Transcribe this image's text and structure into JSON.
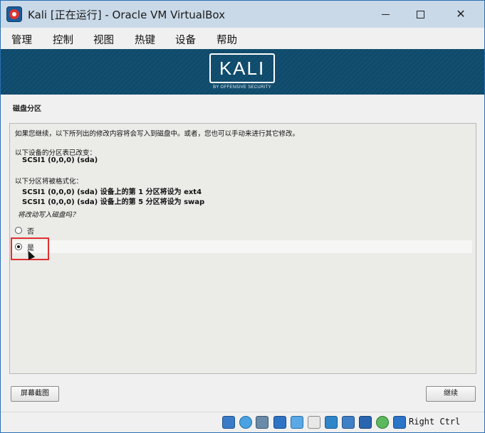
{
  "window": {
    "title": "Kali [正在运行] - Oracle VM VirtualBox"
  },
  "menu": {
    "items": [
      "管理",
      "控制",
      "视图",
      "热键",
      "设备",
      "帮助"
    ]
  },
  "banner": {
    "logo_text": "KALI",
    "logo_subtext": "BY OFFENSIVE SECURITY"
  },
  "installer": {
    "section_title": "磁盘分区",
    "intro": "如果您继续，以下所列出的修改内容将会写入到磁盘中。或者，您也可以手动来进行其它修改。",
    "partition_tables_label": "以下设备的分区表已改变：",
    "partition_tables_device": "SCSI1 (0,0,0) (sda)",
    "format_label": "以下分区将被格式化：",
    "format_items": [
      "SCSI1 (0,0,0) (sda) 设备上的第 1 分区将设为 ext4",
      "SCSI1 (0,0,0) (sda) 设备上的第 5 分区将设为 swap"
    ],
    "question": "将改动写入磁盘吗？",
    "options": [
      {
        "label": "否",
        "selected": false
      },
      {
        "label": "是",
        "selected": true
      }
    ],
    "screenshot_button": "屏幕截图",
    "continue_button": "继续"
  },
  "statusbar": {
    "host_key": "Right Ctrl",
    "icons": [
      "hard-disk-icon",
      "optical-drive-icon",
      "audio-icon",
      "network-icon",
      "usb-icon",
      "shared-folder-icon",
      "display-icon",
      "screen-capture-icon",
      "network-activity-icon",
      "virtualization-icon",
      "mouse-integration-icon",
      "keyboard-capture-icon"
    ]
  },
  "colors": {
    "banner": "#0e4a6b",
    "titlebar": "#c9d9e8",
    "highlight": "#e03030"
  }
}
